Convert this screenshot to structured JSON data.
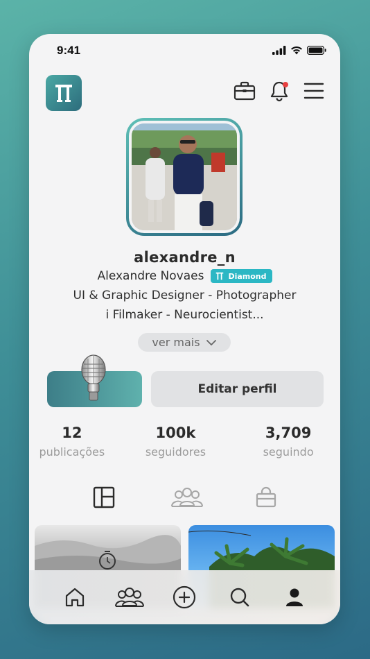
{
  "status_bar": {
    "time": "9:41"
  },
  "header": {
    "logo_icon": "app-logo-icon",
    "actions": [
      {
        "name": "briefcase-icon"
      },
      {
        "name": "bell-icon",
        "has_notification": true
      },
      {
        "name": "menu-icon"
      }
    ]
  },
  "profile": {
    "username": "alexandre_n",
    "full_name": "Alexandre Novaes",
    "badge": "Diamond",
    "bio_line_1": "UI & Graphic Designer - Photographer",
    "bio_line_2": "i Filmaker - Neurocientist...",
    "see_more": "ver mais"
  },
  "actions": {
    "voice_icon": "microphone-icon",
    "edit_profile": "Editar perfil"
  },
  "stats": [
    {
      "value": "12",
      "label": "publicações"
    },
    {
      "value": "100k",
      "label": "seguidores"
    },
    {
      "value": "3,709",
      "label": "seguindo"
    }
  ],
  "tabs": [
    {
      "name": "grid-layout-icon",
      "active": true
    },
    {
      "name": "group-icon",
      "active": false
    },
    {
      "name": "shopping-bag-icon",
      "active": false
    }
  ],
  "bottom_nav": [
    {
      "name": "home-icon"
    },
    {
      "name": "community-icon"
    },
    {
      "name": "add-icon"
    },
    {
      "name": "search-icon"
    },
    {
      "name": "profile-icon"
    }
  ],
  "colors": {
    "accent": "#2bb7c4",
    "brand_teal": "#3d7e88",
    "notification": "#e84040"
  }
}
